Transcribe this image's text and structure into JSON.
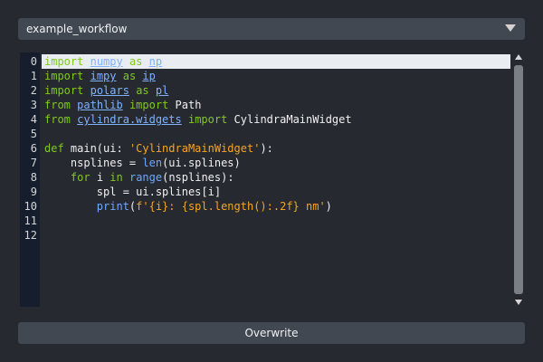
{
  "workflow_select": {
    "value": "example_workflow"
  },
  "editor": {
    "line_numbers": [
      "0",
      "1",
      "2",
      "3",
      "4",
      "5",
      "6",
      "7",
      "8",
      "9",
      "10",
      "11",
      "12"
    ],
    "lines": [
      [
        {
          "t": "import",
          "c": "kw"
        },
        {
          "t": " ",
          "c": "plain"
        },
        {
          "t": "numpy",
          "c": "mod"
        },
        {
          "t": " ",
          "c": "plain"
        },
        {
          "t": "as",
          "c": "kw"
        },
        {
          "t": " ",
          "c": "plain"
        },
        {
          "t": "np",
          "c": "mod"
        }
      ],
      [
        {
          "t": "import",
          "c": "kw"
        },
        {
          "t": " ",
          "c": "plain"
        },
        {
          "t": "impy",
          "c": "mod"
        },
        {
          "t": " ",
          "c": "plain"
        },
        {
          "t": "as",
          "c": "kw"
        },
        {
          "t": " ",
          "c": "plain"
        },
        {
          "t": "ip",
          "c": "mod"
        }
      ],
      [
        {
          "t": "import",
          "c": "kw"
        },
        {
          "t": " ",
          "c": "plain"
        },
        {
          "t": "polars",
          "c": "mod"
        },
        {
          "t": " ",
          "c": "plain"
        },
        {
          "t": "as",
          "c": "kw"
        },
        {
          "t": " ",
          "c": "plain"
        },
        {
          "t": "pl",
          "c": "mod"
        }
      ],
      [
        {
          "t": "from",
          "c": "kw"
        },
        {
          "t": " ",
          "c": "plain"
        },
        {
          "t": "pathlib",
          "c": "mod"
        },
        {
          "t": " ",
          "c": "plain"
        },
        {
          "t": "import",
          "c": "kw"
        },
        {
          "t": " Path",
          "c": "plain"
        }
      ],
      [
        {
          "t": "from",
          "c": "kw"
        },
        {
          "t": " ",
          "c": "plain"
        },
        {
          "t": "cylindra.widgets",
          "c": "mod"
        },
        {
          "t": " ",
          "c": "plain"
        },
        {
          "t": "import",
          "c": "kw"
        },
        {
          "t": " CylindraMainWidget",
          "c": "plain"
        }
      ],
      [],
      [
        {
          "t": "def",
          "c": "kw"
        },
        {
          "t": " main(ui: ",
          "c": "plain"
        },
        {
          "t": "'CylindraMainWidget'",
          "c": "str"
        },
        {
          "t": "):",
          "c": "plain"
        }
      ],
      [
        {
          "t": "    nsplines = ",
          "c": "plain"
        },
        {
          "t": "len",
          "c": "fn"
        },
        {
          "t": "(ui.splines)",
          "c": "plain"
        }
      ],
      [
        {
          "t": "    ",
          "c": "plain"
        },
        {
          "t": "for",
          "c": "kw"
        },
        {
          "t": " i ",
          "c": "plain"
        },
        {
          "t": "in",
          "c": "kw"
        },
        {
          "t": " ",
          "c": "plain"
        },
        {
          "t": "range",
          "c": "fn"
        },
        {
          "t": "(nsplines):",
          "c": "plain"
        }
      ],
      [
        {
          "t": "        spl = ui.splines[i]",
          "c": "plain"
        }
      ],
      [
        {
          "t": "        ",
          "c": "plain"
        },
        {
          "t": "print",
          "c": "fn"
        },
        {
          "t": "(",
          "c": "plain"
        },
        {
          "t": "f'{i}: {spl.length():.2f} nm'",
          "c": "str"
        },
        {
          "t": ")",
          "c": "plain"
        }
      ],
      [],
      []
    ]
  },
  "overwrite_button": {
    "label": "Overwrite"
  },
  "colors": {
    "background": "#262930",
    "control": "#414851",
    "gutter": "#161d2d",
    "current_line": "#e9ecf1",
    "keyword": "#82c91e",
    "module": "#7fb2ff",
    "string": "#f5a623"
  },
  "icons": [
    "dropdown-arrow-icon",
    "scroll-up-icon",
    "scroll-down-icon"
  ]
}
